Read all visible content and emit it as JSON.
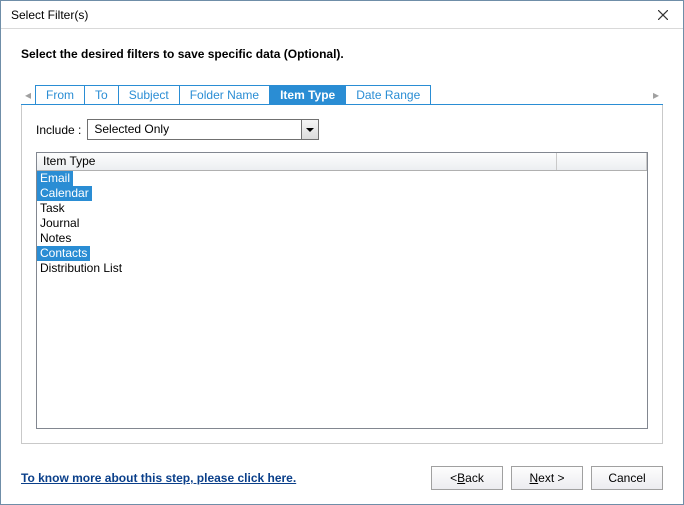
{
  "window": {
    "title": "Select Filter(s)"
  },
  "instruction": "Select the desired filters to save specific data (Optional).",
  "tabs": [
    {
      "label": "From",
      "active": false
    },
    {
      "label": "To",
      "active": false
    },
    {
      "label": "Subject",
      "active": false
    },
    {
      "label": "Folder Name",
      "active": false
    },
    {
      "label": "Item Type",
      "active": true
    },
    {
      "label": "Date Range",
      "active": false
    }
  ],
  "include": {
    "label": "Include :",
    "value": "Selected Only"
  },
  "list": {
    "header": "Item Type",
    "items": [
      {
        "label": "Email",
        "selected": true
      },
      {
        "label": "Calendar",
        "selected": true
      },
      {
        "label": "Task",
        "selected": false
      },
      {
        "label": "Journal",
        "selected": false
      },
      {
        "label": "Notes",
        "selected": false
      },
      {
        "label": "Contacts",
        "selected": true
      },
      {
        "label": "Distribution List",
        "selected": false
      }
    ]
  },
  "help_link": "To know more about this step, please click here.",
  "buttons": {
    "back_prefix": "< ",
    "back_u": "B",
    "back_rest": "ack",
    "next_u": "N",
    "next_rest": "ext >",
    "cancel": "Cancel"
  }
}
